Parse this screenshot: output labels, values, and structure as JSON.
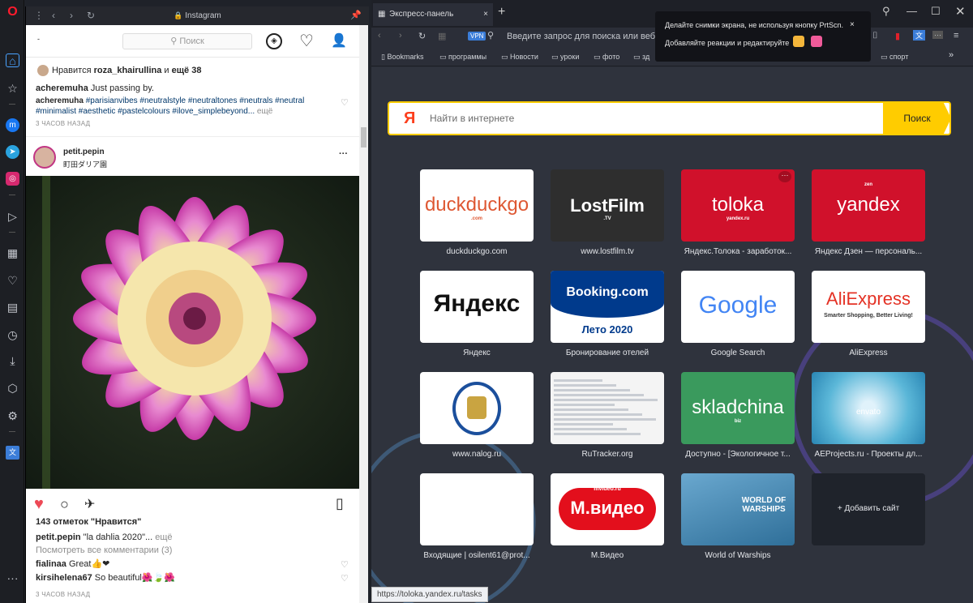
{
  "opera_sidebar": {
    "icons": [
      "opera-logo",
      "home",
      "star",
      "messenger",
      "telegram",
      "instagram",
      "send",
      "apps",
      "heart",
      "news",
      "history",
      "download",
      "cube",
      "settings",
      "translate",
      "more"
    ]
  },
  "instagram": {
    "window_title": "Instagram",
    "header": {
      "arrow": "-",
      "search_placeholder": "Поиск"
    },
    "post1": {
      "likes_line_prefix": "Нравится ",
      "likes_user": "roza_khairullina",
      "likes_line_mid": " и ",
      "likes_line_suffix": "ещё 38",
      "comment1_user": "acheremuha",
      "comment1_text": "Just passing by.",
      "comment2_user": "acheremuha",
      "comment2_tags": "#parisianvibes #neutralstyle #neutraltones #neutrals #neutral",
      "comment2_tags2": "#minimalist #aesthetic #pastelcolours #ilove_simplebeyond...",
      "more": " ещё",
      "time": "3 ЧАСОВ НАЗАД"
    },
    "post2": {
      "user": "petit.pepin",
      "location": "町田ダリア園",
      "likes": "143 отметок \"Нравится\"",
      "caption_user": "petit.pepin",
      "caption_text": "\"la dahlia 2020\"...",
      "caption_more": " ещё",
      "view_all": "Посмотреть все комментарии (3)",
      "c1_user": "fialinaa",
      "c1_text": "Great👍❤",
      "c2_user": "kirsihelena67",
      "c2_text": "So beautiful🌺🍃🌺",
      "time": "3 ЧАСОВ НАЗАД"
    }
  },
  "browser": {
    "tab_title": "Экспресс-панель",
    "vpn": "VPN",
    "address_placeholder": "Введите запрос для поиска или веб-ад",
    "bookmarks": [
      "Bookmarks",
      "программы",
      "Новости",
      "уроки",
      "фото",
      "зд",
      "спорт"
    ],
    "notification": {
      "line1": "Делайте снимки экрана, не используя кнопку PrtScn.",
      "line2": "Добавляйте реакции и редактируйте"
    },
    "yandex_search": {
      "logo": "Я",
      "placeholder": "Найти в интернете",
      "button": "Поиск"
    },
    "tiles": [
      {
        "name": "duckduckgo",
        "label": "duckduckgo.com",
        "text": "duckduckgo",
        "sub": ".com",
        "bg": "#ffffff",
        "fg": "#de5833"
      },
      {
        "name": "lostfilm",
        "label": "www.lostfilm.tv",
        "text": "LostFilm",
        "sub": ".TV",
        "bg": "#2e2e2e",
        "fg": "#ffffff"
      },
      {
        "name": "toloka",
        "label": "Яндекс.Толока - заработок...",
        "text": "toloka",
        "sub": "yandex.ru",
        "bg": "#d0112b",
        "fg": "#ffffff"
      },
      {
        "name": "yandex-zen",
        "label": "Яндекс Дзен — персональ...",
        "text": "yandex",
        "sub": "zen",
        "bg": "#d0112b",
        "fg": "#ffffff"
      },
      {
        "name": "yandex",
        "label": "Яндекс",
        "text": "Яндекс",
        "sub": "",
        "bg": "#ffffff",
        "fg": "#111111"
      },
      {
        "name": "booking",
        "label": "Бронирование отелей",
        "text": "Booking.com",
        "sub": "Лето 2020",
        "bg": "#ffffff",
        "fg": "#ffffff"
      },
      {
        "name": "google",
        "label": "Google Search",
        "text": "Google",
        "sub": "",
        "bg": "#ffffff",
        "fg": "#4285f4"
      },
      {
        "name": "aliexpress",
        "label": "AliExpress",
        "text": "AliExpress",
        "sub": "Smarter Shopping, Better Living!",
        "bg": "#ffffff",
        "fg": "#e43225"
      },
      {
        "name": "nalog",
        "label": "www.nalog.ru",
        "text": "",
        "sub": "",
        "bg": "#ffffff",
        "fg": "#1b4f9c"
      },
      {
        "name": "rutracker",
        "label": "RuTracker.org",
        "text": "",
        "sub": "",
        "bg": "#f4f4f4",
        "fg": "#333333"
      },
      {
        "name": "skladchina",
        "label": "Доступно - [Экологичное т...",
        "text": "skladchina",
        "sub": "biz",
        "bg": "#3a9a5d",
        "fg": "#ffffff"
      },
      {
        "name": "aeprojects",
        "label": "AEProjects.ru - Проекты дл...",
        "text": "envato",
        "sub": "",
        "bg": "#5bb7d8",
        "fg": "#ffffff"
      },
      {
        "name": "mail",
        "label": "Входящие | osilent61@prot...",
        "text": "",
        "sub": "",
        "bg": "#ffffff",
        "fg": "#333333"
      },
      {
        "name": "mvideo",
        "label": "М.Видео",
        "text": "М.видео",
        "sub": "mvideo.ru",
        "bg": "#ffffff",
        "fg": "#ffffff"
      },
      {
        "name": "wot",
        "label": "World of Warships",
        "text": "WORLD OF WARSHIPS",
        "sub": "",
        "bg": "#3c7ea8",
        "fg": "#ffffff"
      },
      {
        "name": "add-site",
        "label": "",
        "text": "+ Добавить сайт",
        "sub": "",
        "bg": "#1f232b",
        "fg": "#e4e6ea"
      }
    ],
    "status_url": "https://toloka.yandex.ru/tasks"
  }
}
